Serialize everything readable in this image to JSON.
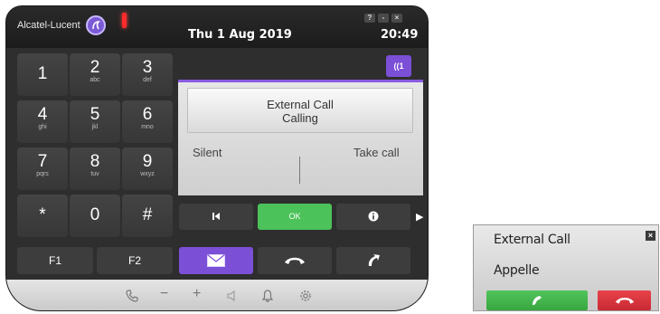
{
  "header": {
    "brand": "Alcatel-Lucent",
    "date": "Thu 1 Aug 2019",
    "time": "20:49",
    "window_controls": [
      "?",
      "-",
      "×"
    ]
  },
  "keypad": [
    {
      "digit": "1",
      "letters": ""
    },
    {
      "digit": "2",
      "letters": "abc"
    },
    {
      "digit": "3",
      "letters": "def"
    },
    {
      "digit": "4",
      "letters": "ghi"
    },
    {
      "digit": "5",
      "letters": "jkl"
    },
    {
      "digit": "6",
      "letters": "mno"
    },
    {
      "digit": "7",
      "letters": "pqrs"
    },
    {
      "digit": "8",
      "letters": "tuv"
    },
    {
      "digit": "9",
      "letters": "wxyz"
    },
    {
      "digit": "*",
      "letters": ""
    },
    {
      "digit": "0",
      "letters": ""
    },
    {
      "digit": "#",
      "letters": ""
    }
  ],
  "function_keys": [
    "F1",
    "F2"
  ],
  "contacts_button": "((1",
  "call": {
    "name": "External Call",
    "status": "Calling",
    "left_action": "Silent",
    "right_action": "Take call"
  },
  "actions": {
    "ok": "OK",
    "more_arrow": "▶"
  },
  "popup": {
    "name": "External Call",
    "status": "Appelle",
    "close": "×"
  },
  "colors": {
    "accent": "#7b4fd6",
    "answer_green": "#4cc25a",
    "reject_red": "#d9343c",
    "alert_red": "#ff2a2a"
  },
  "icons": {
    "footer": [
      "phone-icon",
      "minus-icon",
      "plus-icon",
      "speaker-icon",
      "bell-icon",
      "gear-icon"
    ],
    "actions": [
      "previous-icon",
      "info-icon",
      "arrow-right-icon"
    ],
    "bottom": [
      "mail-icon",
      "hangup-icon",
      "transfer-call-icon"
    ]
  }
}
